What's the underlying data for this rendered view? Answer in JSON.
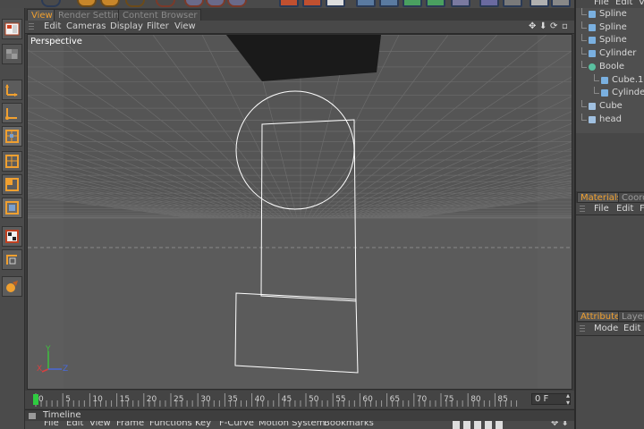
{
  "tabs": [
    {
      "label": "View",
      "active": true
    },
    {
      "label": "Render Settings",
      "active": false
    },
    {
      "label": "Content Browser",
      "active": false
    }
  ],
  "viewport_menu": [
    "Edit",
    "Cameras",
    "Display",
    "Filter",
    "View"
  ],
  "viewport": {
    "label": "Perspective",
    "axis_y": "Y",
    "axis_x": "X",
    "axis_z": "Z"
  },
  "timeline": {
    "ticks": [
      "0",
      "5",
      "10",
      "15",
      "20",
      "25",
      "30",
      "35",
      "40",
      "45",
      "50",
      "55",
      "60",
      "65",
      "70",
      "75",
      "80",
      "85",
      "90"
    ],
    "current_frame": "0 F",
    "title": "Timeline",
    "menu": [
      "File",
      "Edit",
      "View",
      "Frame",
      "Functions",
      "Key",
      "F-Curve",
      "Motion System",
      "Bookmarks"
    ]
  },
  "object_manager": {
    "menu": [
      "File",
      "Edit",
      "V"
    ],
    "objects": [
      {
        "label": "Spline",
        "icon": "spline-icon",
        "depth": 0
      },
      {
        "label": "Spline",
        "icon": "spline-icon",
        "depth": 0
      },
      {
        "label": "Spline",
        "icon": "spline-icon",
        "depth": 0
      },
      {
        "label": "Cylinder",
        "icon": "cylinder-icon",
        "depth": 0
      },
      {
        "label": "Boole",
        "icon": "boole-icon",
        "depth": 0
      },
      {
        "label": "Cube.1",
        "icon": "cube-icon",
        "depth": 1
      },
      {
        "label": "Cylinder.1",
        "icon": "cylinder-icon",
        "depth": 1
      },
      {
        "label": "Cube",
        "icon": "null-icon",
        "depth": 0
      },
      {
        "label": "head",
        "icon": "null-icon",
        "depth": 0
      }
    ]
  },
  "materials": {
    "tabs": [
      {
        "label": "Materials",
        "active": true
      },
      {
        "label": "Coord",
        "active": false
      }
    ],
    "menu": [
      "File",
      "Edit",
      "F"
    ]
  },
  "attributes": {
    "tabs": [
      {
        "label": "Attributes",
        "active": true
      },
      {
        "label": "Layer",
        "active": false
      }
    ],
    "menu": [
      "Mode",
      "Edit"
    ]
  },
  "colors": {
    "accent": "#f0a030",
    "viewport_bg": "#595959",
    "wireframe": "#ffffff",
    "playhead": "#2ecc40"
  }
}
